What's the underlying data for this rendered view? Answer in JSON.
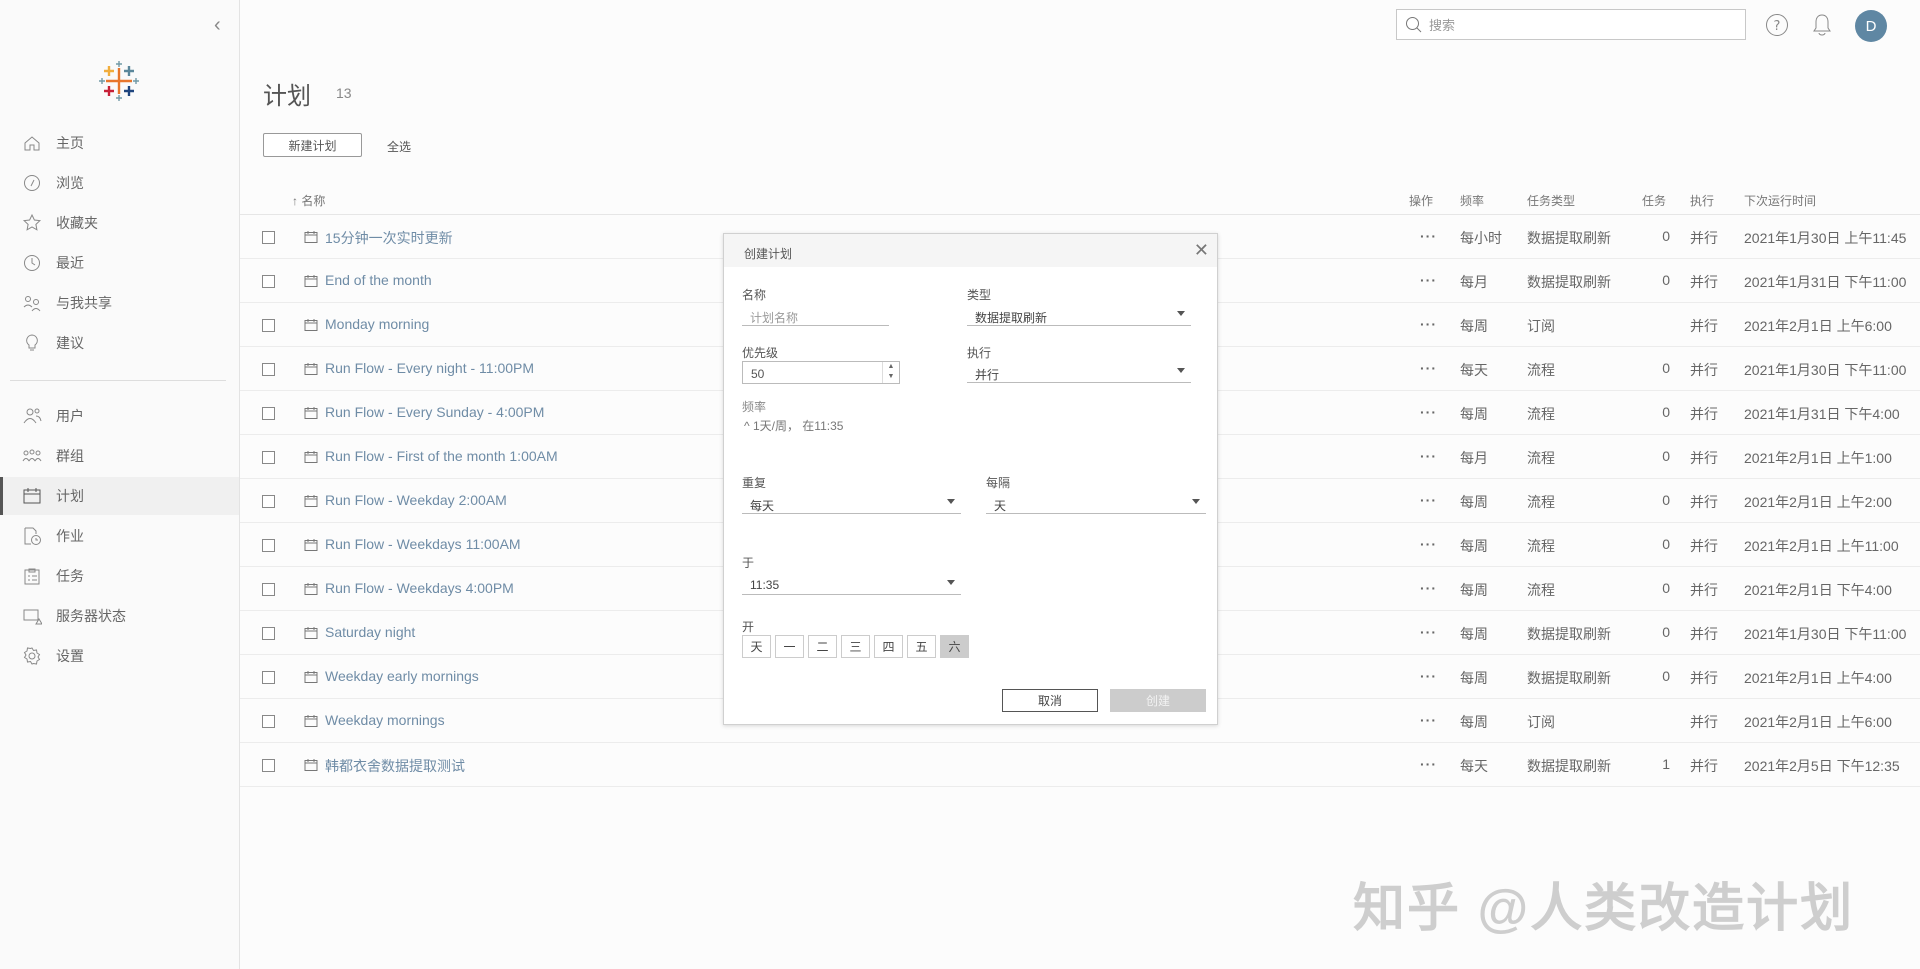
{
  "sidebar": {
    "items": [
      {
        "label": "主页",
        "icon": "home-icon"
      },
      {
        "label": "浏览",
        "icon": "compass-icon"
      },
      {
        "label": "收藏夹",
        "icon": "star-icon"
      },
      {
        "label": "最近",
        "icon": "clock-icon"
      },
      {
        "label": "与我共享",
        "icon": "shared-icon"
      },
      {
        "label": "建议",
        "icon": "lightbulb-icon"
      },
      {
        "label": "用户",
        "icon": "users-icon"
      },
      {
        "label": "群组",
        "icon": "groups-icon"
      },
      {
        "label": "计划",
        "icon": "calendar-icon",
        "active": true
      },
      {
        "label": "作业",
        "icon": "jobs-icon"
      },
      {
        "label": "任务",
        "icon": "tasks-icon"
      },
      {
        "label": "服务器状态",
        "icon": "server-status-icon"
      },
      {
        "label": "设置",
        "icon": "gear-icon"
      }
    ]
  },
  "header": {
    "search_placeholder": "搜索",
    "avatar_initial": "D"
  },
  "page": {
    "title": "计划",
    "count": "13",
    "new_button": "新建计划",
    "select_all": "全选"
  },
  "table": {
    "columns": {
      "name": "↑ 名称",
      "actions": "操作",
      "frequency": "频率",
      "task_type": "任务类型",
      "tasks": "任务",
      "execution": "执行",
      "next_run": "下次运行时间"
    },
    "rows": [
      {
        "name": "15分钟一次实时更新",
        "frequency": "每小时",
        "task_type": "数据提取刷新",
        "tasks": "0",
        "execution": "并行",
        "next_run": "2021年1月30日 上午11:45"
      },
      {
        "name": "End of the month",
        "frequency": "每月",
        "task_type": "数据提取刷新",
        "tasks": "0",
        "execution": "并行",
        "next_run": "2021年1月31日 下午11:00"
      },
      {
        "name": "Monday morning",
        "frequency": "每周",
        "task_type": "订阅",
        "tasks": "",
        "execution": "并行",
        "next_run": "2021年2月1日 上午6:00"
      },
      {
        "name": "Run Flow - Every night - 11:00PM",
        "frequency": "每天",
        "task_type": "流程",
        "tasks": "0",
        "execution": "并行",
        "next_run": "2021年1月30日 下午11:00"
      },
      {
        "name": "Run Flow - Every Sunday - 4:00PM",
        "frequency": "每周",
        "task_type": "流程",
        "tasks": "0",
        "execution": "并行",
        "next_run": "2021年1月31日 下午4:00"
      },
      {
        "name": "Run Flow - First of the month 1:00AM",
        "frequency": "每月",
        "task_type": "流程",
        "tasks": "0",
        "execution": "并行",
        "next_run": "2021年2月1日 上午1:00"
      },
      {
        "name": "Run Flow - Weekday 2:00AM",
        "frequency": "每周",
        "task_type": "流程",
        "tasks": "0",
        "execution": "并行",
        "next_run": "2021年2月1日 上午2:00"
      },
      {
        "name": "Run Flow - Weekdays 11:00AM",
        "frequency": "每周",
        "task_type": "流程",
        "tasks": "0",
        "execution": "并行",
        "next_run": "2021年2月1日 上午11:00"
      },
      {
        "name": "Run Flow - Weekdays 4:00PM",
        "frequency": "每周",
        "task_type": "流程",
        "tasks": "0",
        "execution": "并行",
        "next_run": "2021年2月1日 下午4:00"
      },
      {
        "name": "Saturday night",
        "frequency": "每周",
        "task_type": "数据提取刷新",
        "tasks": "0",
        "execution": "并行",
        "next_run": "2021年1月30日 下午11:00"
      },
      {
        "name": "Weekday early mornings",
        "frequency": "每周",
        "task_type": "数据提取刷新",
        "tasks": "0",
        "execution": "并行",
        "next_run": "2021年2月1日 上午4:00"
      },
      {
        "name": "Weekday mornings",
        "frequency": "每周",
        "task_type": "订阅",
        "tasks": "",
        "execution": "并行",
        "next_run": "2021年2月1日 上午6:00"
      },
      {
        "name": "韩都衣舍数据提取测试",
        "frequency": "每天",
        "task_type": "数据提取刷新",
        "tasks": "1",
        "execution": "并行",
        "next_run": "2021年2月5日 下午12:35"
      }
    ]
  },
  "dialog": {
    "title": "创建计划",
    "name_label": "名称",
    "name_placeholder": "计划名称",
    "type_label": "类型",
    "type_value": "数据提取刷新",
    "priority_label": "优先级",
    "priority_value": "50",
    "exec_label": "执行",
    "exec_value": "并行",
    "freq_label": "频率",
    "freq_summary": "1天/周， 在11:35",
    "repeat_label": "重复",
    "repeat_value": "每天",
    "every_label": "每隔",
    "every_value": "天",
    "at_label": "于",
    "at_value": "11:35",
    "on_label": "开",
    "days": [
      {
        "label": "天"
      },
      {
        "label": "一"
      },
      {
        "label": "二"
      },
      {
        "label": "三"
      },
      {
        "label": "四"
      },
      {
        "label": "五"
      },
      {
        "label": "六",
        "selected": true
      }
    ],
    "cancel": "取消",
    "create": "创建"
  },
  "watermark": "知乎 @人类改造计划"
}
